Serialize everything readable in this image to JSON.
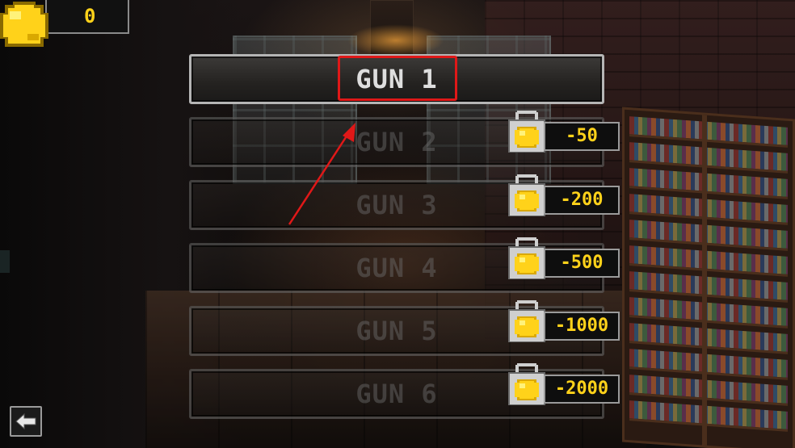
{
  "currency": {
    "coins": "0",
    "icon": "gold-coin-icon",
    "coin_color": "#ffd21a"
  },
  "guns": [
    {
      "label": "GUN 1",
      "state": "selected"
    },
    {
      "label": "GUN 2",
      "state": "locked",
      "price": "-50"
    },
    {
      "label": "GUN 3",
      "state": "locked",
      "price": "-200"
    },
    {
      "label": "GUN 4",
      "state": "locked",
      "price": "-500"
    },
    {
      "label": "GUN 5",
      "state": "locked",
      "price": "-1000"
    },
    {
      "label": "GUN 6",
      "state": "locked",
      "price": "-2000"
    }
  ],
  "back_button": {
    "icon": "back-arrow-icon"
  },
  "annotation": {
    "highlight_color": "#e01818"
  }
}
